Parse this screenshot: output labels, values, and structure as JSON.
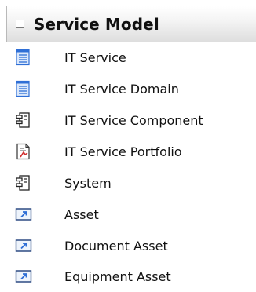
{
  "section": {
    "title": "Service Model"
  },
  "items": [
    {
      "label": "IT Service",
      "icon": "service-doc-icon"
    },
    {
      "label": "IT Service Domain",
      "icon": "service-doc-icon"
    },
    {
      "label": "IT Service Component",
      "icon": "component-icon"
    },
    {
      "label": "IT Service Portfolio",
      "icon": "portfolio-icon"
    },
    {
      "label": "System",
      "icon": "component-icon"
    },
    {
      "label": "Asset",
      "icon": "asset-icon"
    },
    {
      "label": "Document Asset",
      "icon": "asset-icon"
    },
    {
      "label": "Equipment Asset",
      "icon": "asset-icon"
    }
  ],
  "colors": {
    "accent": "#2f6fd6",
    "portfolio_red": "#d03030"
  }
}
